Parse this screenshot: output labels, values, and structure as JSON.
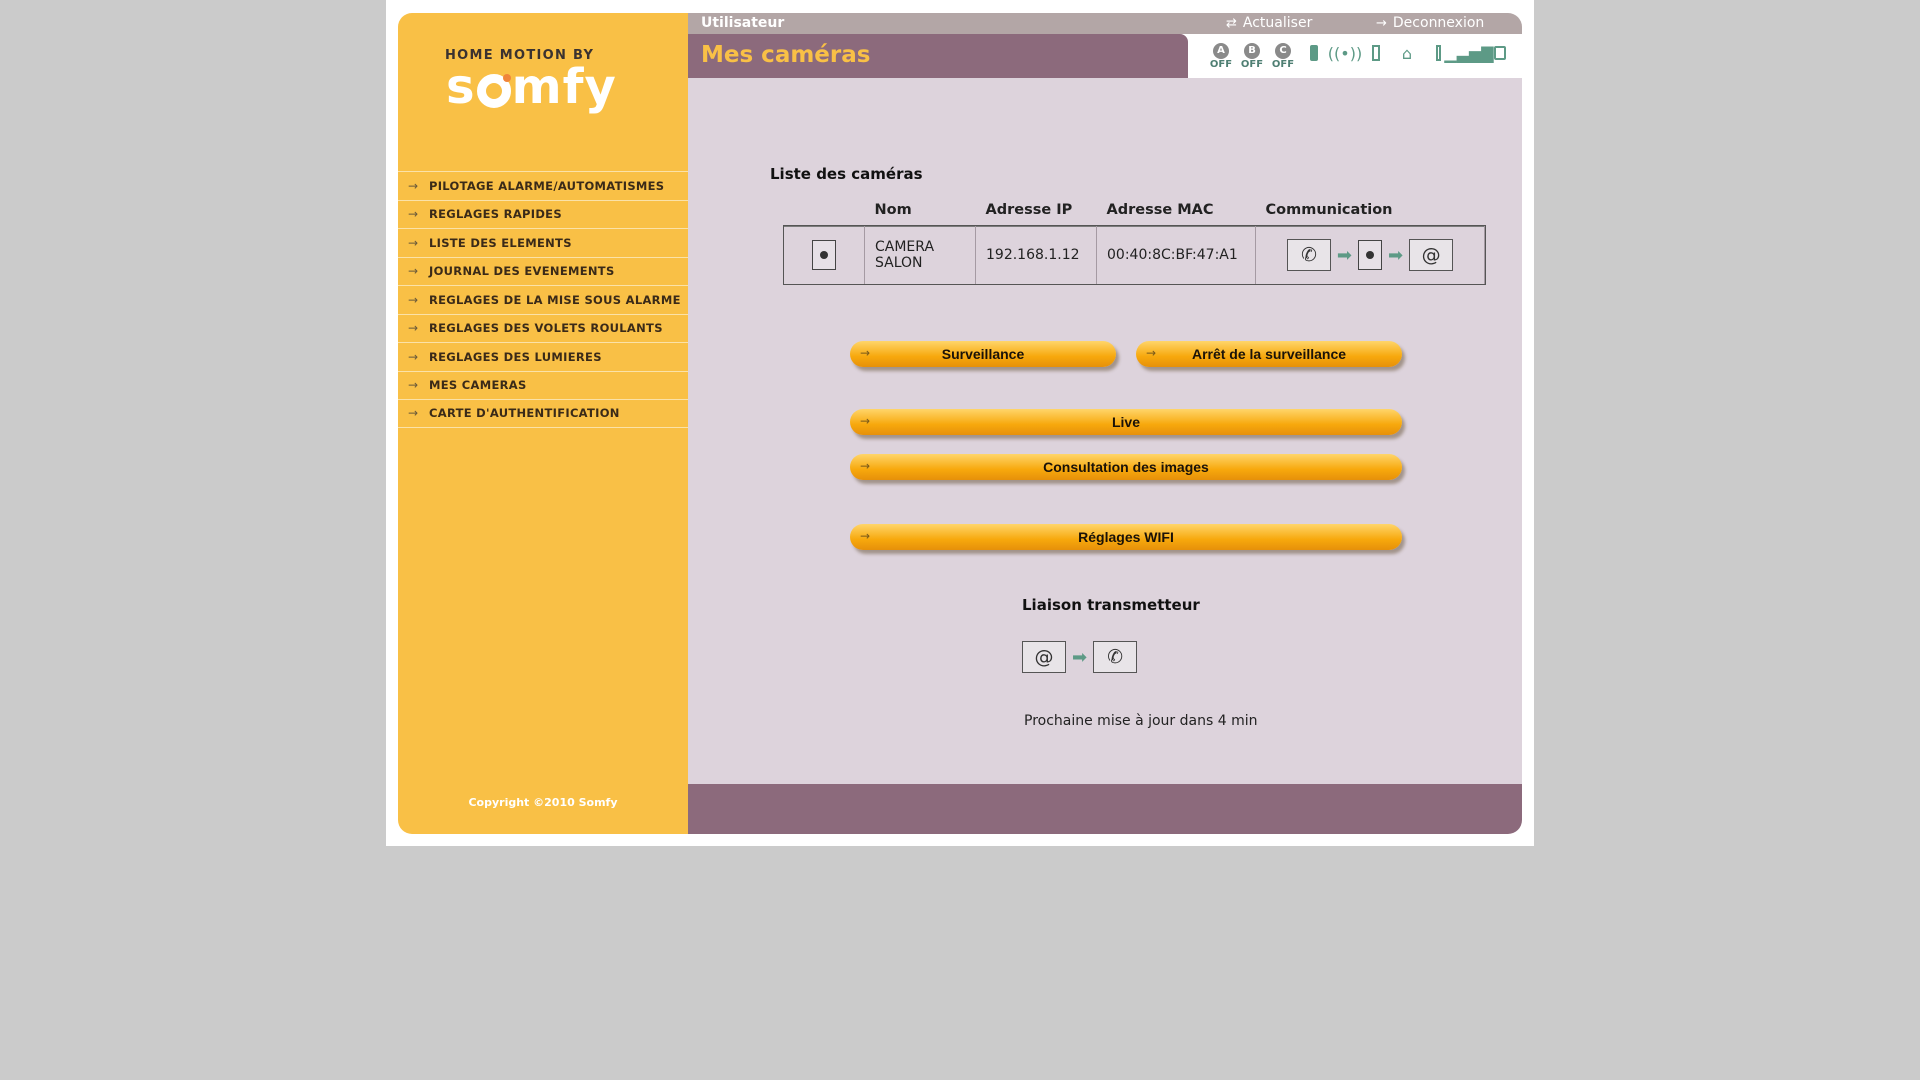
{
  "brand": {
    "tagline": "HOME MOTION BY",
    "logo": "somfy"
  },
  "topbar": {
    "user": "Utilisateur",
    "refresh": "Actualiser",
    "logout": "Deconnexion"
  },
  "page": {
    "title": "Mes caméras"
  },
  "status": {
    "zones": [
      {
        "letter": "A",
        "state": "OFF"
      },
      {
        "letter": "B",
        "state": "OFF"
      },
      {
        "letter": "C",
        "state": "OFF"
      }
    ]
  },
  "nav": [
    "PILOTAGE ALARME/AUTOMATISMES",
    "REGLAGES RAPIDES",
    "LISTE DES ELEMENTS",
    "JOURNAL DES EVENEMENTS",
    "REGLAGES DE LA MISE SOUS ALARME",
    "REGLAGES DES VOLETS ROULANTS",
    "REGLAGES DES LUMIERES",
    "MES CAMERAS",
    "CARTE D'AUTHENTIFICATION"
  ],
  "cameras": {
    "section_title": "Liste des caméras",
    "headers": {
      "name": "Nom",
      "ip": "Adresse IP",
      "mac": "Adresse MAC",
      "comm": "Communication"
    },
    "rows": [
      {
        "name_line1": "CAMERA",
        "name_line2": "SALON",
        "ip": "192.168.1.12",
        "mac": "00:40:8C:BF:47:A1"
      }
    ]
  },
  "buttons": {
    "surveillance": "Surveillance",
    "stop": "Arrêt de la surveillance",
    "live": "Live",
    "images": "Consultation des images",
    "wifi": "Réglages WIFI"
  },
  "transmitter": {
    "title": "Liaison transmetteur",
    "update": "Prochaine mise à jour dans 4 min"
  },
  "footer": {
    "copyright": "Copyright ©2010 Somfy"
  },
  "colors": {
    "sidebar": "#f9c046",
    "header": "#8c6a7c",
    "content": "#ddd3dc",
    "accent_icon": "#5d9a86"
  }
}
